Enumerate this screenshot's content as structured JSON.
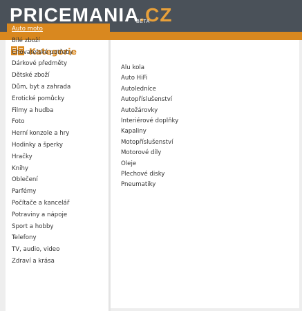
{
  "header": {
    "logo_price": "PRICE",
    "logo_mania": "MANIA",
    "logo_dot": ".",
    "logo_cz": "CZ",
    "logo_beta": "BETA"
  },
  "sidebar": {
    "title": "Kategorie",
    "icon": "book-icon",
    "items": [
      {
        "label": "Auto moto",
        "active": true
      },
      {
        "label": "Bílé zboží"
      },
      {
        "label": "Chovatelské potřeby"
      },
      {
        "label": "Dárkové předměty"
      },
      {
        "label": "Dětské zboží"
      },
      {
        "label": "Dům, byt a zahrada"
      },
      {
        "label": "Erotické pomůcky"
      },
      {
        "label": "Filmy a hudba"
      },
      {
        "label": "Foto"
      },
      {
        "label": "Herní konzole a hry"
      },
      {
        "label": "Hodinky a šperky"
      },
      {
        "label": "Hračky"
      },
      {
        "label": "Knihy"
      },
      {
        "label": "Oblečení"
      },
      {
        "label": "Parfémy"
      },
      {
        "label": "Počítače a kancelář"
      },
      {
        "label": "Potraviny a nápoje"
      },
      {
        "label": "Sport a hobby"
      },
      {
        "label": "Telefony"
      },
      {
        "label": "TV, audio, video"
      },
      {
        "label": "Zdraví a krása"
      }
    ]
  },
  "subcategories": {
    "items": [
      "Alu kola",
      "Auto HiFi",
      "Autoledníce",
      "Autopříslušenství",
      "Autožárovky",
      "Interiérové doplňky",
      "Kapaliny",
      "Motopříslušenství",
      "Motorové díly",
      "Oleje",
      "Plechové disky",
      "Pneumatiky"
    ]
  },
  "colors": {
    "header_bg": "#4a5159",
    "accent": "#d9881f",
    "page_bg": "#eeeeee",
    "text": "#333333"
  }
}
